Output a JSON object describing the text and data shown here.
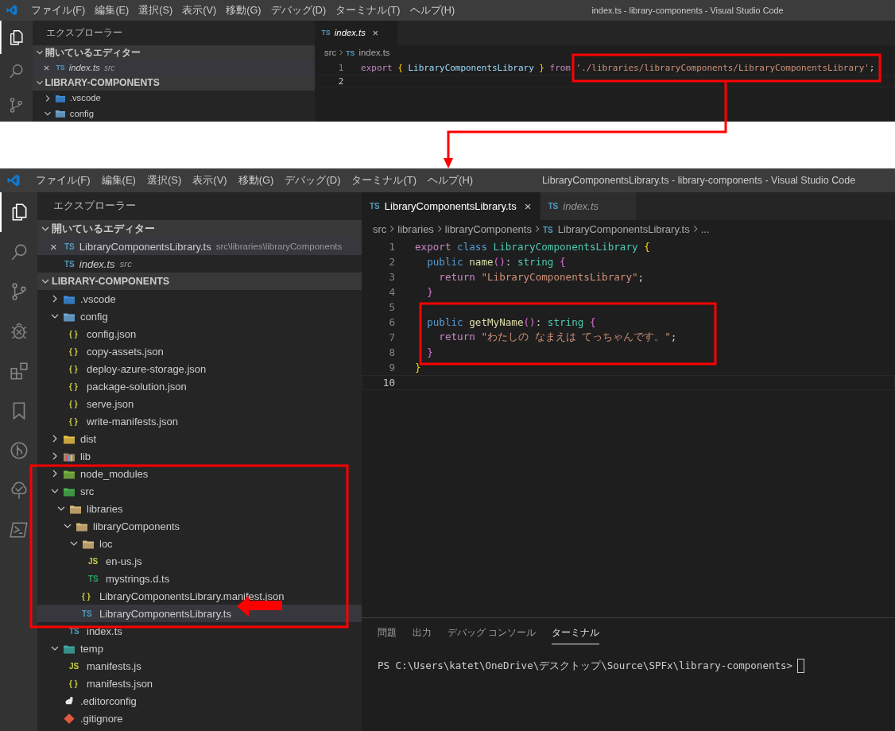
{
  "top": {
    "title": "index.ts - library-components - Visual Studio Code",
    "menu": [
      "ファイル(F)",
      "編集(E)",
      "選択(S)",
      "表示(V)",
      "移動(G)",
      "デバッグ(D)",
      "ターミナル(T)",
      "ヘルプ(H)"
    ],
    "activity": [
      {
        "kind": "files",
        "selected": true
      },
      {
        "kind": "search",
        "selected": false
      },
      {
        "kind": "scm",
        "selected": false
      }
    ],
    "sidebar": {
      "title": "エクスプローラー",
      "sections": [
        {
          "title": "開いているエディター",
          "expanded": true,
          "kind": "editors",
          "items": [
            {
              "name": "index.ts",
              "badge": "TS",
              "description": "src",
              "preview": true,
              "selected": true,
              "close": "×"
            }
          ]
        },
        {
          "title": "LIBRARY-COMPONENTS",
          "expanded": true,
          "kind": "tree",
          "items": [
            {
              "name": ".vscode",
              "kind": "vscode",
              "expanded": false,
              "selected": false
            },
            {
              "name": "config",
              "kind": "config",
              "expanded": true,
              "selected": false
            }
          ]
        }
      ]
    },
    "tabs": [
      {
        "badge": "TS",
        "name": "index.ts",
        "preview": true,
        "selected": true,
        "close": "×"
      }
    ],
    "breadcrumbs": [
      {
        "text": "src"
      },
      {
        "badge": "TS",
        "text": "index.ts"
      }
    ],
    "lines": [
      {
        "number": "1",
        "active": false,
        "tokens": [
          {
            "text": "export ",
            "kind": "control"
          },
          {
            "text": "{ ",
            "kind": "bracket1"
          },
          {
            "text": "LibraryComponentsLibrary ",
            "kind": "var"
          },
          {
            "text": "} ",
            "kind": "bracket1"
          },
          {
            "text": "from ",
            "kind": "control"
          },
          {
            "text": "'./libraries/libraryComponents/LibraryComponentsLibrary'",
            "kind": "string"
          },
          {
            "text": ";"
          }
        ]
      },
      {
        "number": "2",
        "active": true
      }
    ]
  },
  "bottom": {
    "title": "LibraryComponentsLibrary.ts - library-components - Visual Studio Code",
    "menu": [
      "ファイル(F)",
      "編集(E)",
      "選択(S)",
      "表示(V)",
      "移動(G)",
      "デバッグ(D)",
      "ターミナル(T)",
      "ヘルプ(H)"
    ],
    "activity": [
      {
        "kind": "files",
        "selected": true
      },
      {
        "kind": "search",
        "selected": false
      },
      {
        "kind": "scm",
        "selected": false
      },
      {
        "kind": "debug",
        "selected": false
      },
      {
        "kind": "extensions",
        "selected": false
      },
      {
        "kind": "bookmark",
        "selected": false
      },
      {
        "kind": "graph",
        "selected": false
      },
      {
        "kind": "tree",
        "selected": false
      },
      {
        "kind": "terminal",
        "selected": false
      }
    ],
    "sidebar": {
      "title": "エクスプローラー",
      "sections": [
        {
          "title": "開いているエディター",
          "expanded": true,
          "kind": "editors",
          "items": [
            {
              "name": "LibraryComponentsLibrary.ts",
              "badge": "TS",
              "description": "src\\libraries\\libraryComponents",
              "preview": false,
              "selected": true,
              "close": "×"
            },
            {
              "name": "index.ts",
              "badge": "TS",
              "description": "src",
              "preview": true,
              "selected": false
            }
          ]
        },
        {
          "title": "LIBRARY-COMPONENTS",
          "expanded": true,
          "kind": "tree",
          "items": [
            {
              "name": ".vscode",
              "kind": "vscode",
              "expanded": false,
              "selected": false
            },
            {
              "name": "config",
              "kind": "config",
              "expanded": true,
              "selected": false,
              "children": [
                {
                  "name": "config.json",
                  "kind": "json",
                  "badge": "{ }",
                  "selected": false
                },
                {
                  "name": "copy-assets.json",
                  "kind": "json",
                  "badge": "{ }",
                  "selected": false
                },
                {
                  "name": "deploy-azure-storage.json",
                  "kind": "json",
                  "badge": "{ }",
                  "selected": false
                },
                {
                  "name": "package-solution.json",
                  "kind": "json",
                  "badge": "{ }",
                  "selected": false
                },
                {
                  "name": "serve.json",
                  "kind": "json",
                  "badge": "{ }",
                  "selected": false
                },
                {
                  "name": "write-manifests.json",
                  "kind": "json",
                  "badge": "{ }",
                  "selected": false
                }
              ]
            },
            {
              "name": "dist",
              "kind": "dist",
              "expanded": false,
              "selected": false
            },
            {
              "name": "lib",
              "kind": "lib",
              "expanded": false,
              "selected": false
            },
            {
              "name": "node_modules",
              "kind": "node",
              "expanded": false,
              "selected": false
            },
            {
              "name": "src",
              "kind": "src",
              "expanded": true,
              "selected": false,
              "children": [
                {
                  "name": "libraries",
                  "kind": "folder",
                  "expanded": true,
                  "selected": false,
                  "children": [
                    {
                      "name": "libraryComponents",
                      "kind": "folder",
                      "expanded": true,
                      "selected": false,
                      "children": [
                        {
                          "name": "loc",
                          "kind": "folder",
                          "expanded": true,
                          "selected": false,
                          "children": [
                            {
                              "name": "en-us.js",
                              "kind": "js",
                              "badge": "JS",
                              "selected": false
                            },
                            {
                              "name": "mystrings.d.ts",
                              "kind": "dts",
                              "badge": "TS",
                              "selected": false
                            }
                          ]
                        },
                        {
                          "name": "LibraryComponentsLibrary.manifest.json",
                          "kind": "json",
                          "badge": "{ }",
                          "selected": false
                        },
                        {
                          "name": "LibraryComponentsLibrary.ts",
                          "kind": "ts",
                          "badge": "TS",
                          "selected": true
                        }
                      ]
                    }
                  ]
                },
                {
                  "name": "index.ts",
                  "kind": "ts",
                  "badge": "TS",
                  "selected": false
                }
              ]
            },
            {
              "name": "temp",
              "kind": "temp",
              "expanded": true,
              "selected": false,
              "children": [
                {
                  "name": "manifests.js",
                  "kind": "js",
                  "badge": "JS",
                  "selected": false
                },
                {
                  "name": "manifests.json",
                  "kind": "json",
                  "badge": "{ }",
                  "selected": false
                }
              ]
            },
            {
              "name": ".editorconfig",
              "kind": "editorconfig",
              "selected": false
            },
            {
              "name": ".gitignore",
              "kind": "git",
              "selected": false
            }
          ]
        }
      ]
    },
    "tabs": [
      {
        "badge": "TS",
        "name": "LibraryComponentsLibrary.ts",
        "preview": false,
        "selected": true,
        "close": "×"
      },
      {
        "badge": "TS",
        "name": "index.ts",
        "preview": true,
        "selected": false
      }
    ],
    "breadcrumbs": [
      {
        "text": "src"
      },
      {
        "text": "libraries"
      },
      {
        "text": "libraryComponents"
      },
      {
        "badge": "TS",
        "text": "LibraryComponentsLibrary.ts"
      },
      {
        "text": "..."
      }
    ],
    "lines": [
      {
        "number": "1",
        "active": false,
        "tokens": [
          {
            "text": "export ",
            "kind": "control"
          },
          {
            "text": "class ",
            "kind": "keyword"
          },
          {
            "text": "LibraryComponentsLibrary ",
            "kind": "type"
          },
          {
            "text": "{",
            "kind": "bracket1"
          }
        ]
      },
      {
        "number": "2",
        "active": false,
        "tokens": [
          {
            "text": "  public ",
            "kind": "keyword"
          },
          {
            "text": "name",
            "kind": "func"
          },
          {
            "text": "()",
            "kind": "bracket2"
          },
          {
            "text": ": "
          },
          {
            "text": "string ",
            "kind": "type"
          },
          {
            "text": "{",
            "kind": "bracket2"
          }
        ]
      },
      {
        "number": "3",
        "active": false,
        "tokens": [
          {
            "text": "    return ",
            "kind": "control"
          },
          {
            "text": "\"LibraryComponentsLibrary\"",
            "kind": "string"
          },
          {
            "text": ";"
          }
        ]
      },
      {
        "number": "4",
        "active": false,
        "tokens": [
          {
            "text": "  }",
            "kind": "bracket2"
          }
        ]
      },
      {
        "number": "5",
        "active": false
      },
      {
        "number": "6",
        "active": false,
        "tokens": [
          {
            "text": "  public ",
            "kind": "keyword"
          },
          {
            "text": "getMyName",
            "kind": "func"
          },
          {
            "text": "()",
            "kind": "bracket2"
          },
          {
            "text": ": "
          },
          {
            "text": "string ",
            "kind": "type"
          },
          {
            "text": "{",
            "kind": "bracket2"
          }
        ]
      },
      {
        "number": "7",
        "active": false,
        "tokens": [
          {
            "text": "    return ",
            "kind": "control"
          },
          {
            "text": "\"わたしの なまえは てっちゃんです。\"",
            "kind": "string"
          },
          {
            "text": ";"
          }
        ]
      },
      {
        "number": "8",
        "active": false,
        "tokens": [
          {
            "text": "  }",
            "kind": "bracket2"
          }
        ]
      },
      {
        "number": "9",
        "active": false,
        "tokens": [
          {
            "text": "}",
            "kind": "bracket1"
          }
        ]
      },
      {
        "number": "10",
        "active": true
      }
    ],
    "panel": {
      "tabs": [
        {
          "label": "問題",
          "selected": false
        },
        {
          "label": "出力",
          "selected": false
        },
        {
          "label": "デバッグ コンソール",
          "selected": false
        },
        {
          "label": "ターミナル",
          "selected": true
        }
      ],
      "terminal": "PS C:\\Users\\katet\\OneDrive\\デスクトップ\\Source\\SPFx\\library-components>"
    }
  }
}
